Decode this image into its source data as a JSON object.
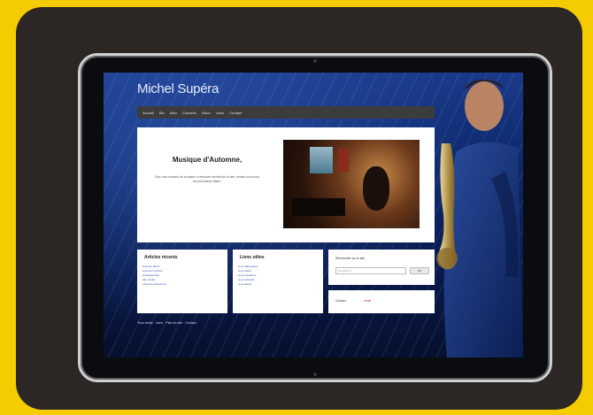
{
  "site": {
    "title": "Michel Supéra",
    "nav": [
      "Accueil",
      "Bio",
      "Actu",
      "Concerts",
      "Disco",
      "Liens",
      "Contact"
    ]
  },
  "hero": {
    "title": "Musique d'Automne,",
    "text": "Tous nos concerts de la saison à retrouver bientôt sur le site, rendez-vous pour les prochaines dates."
  },
  "articles_box": {
    "title": "Articles récents",
    "items": [
      "Nouvel album",
      "Concert à Paris",
      "Festival d'été",
      "En studio",
      "Tournée d'automne"
    ]
  },
  "links_box": {
    "title": "Liens utiles",
    "items": [
      "Les partenaires",
      "Les salles",
      "Les musiciens",
      "Les festivals",
      "Les labels"
    ]
  },
  "search_box": {
    "label": "Rechercher sur le site",
    "placeholder": "Recherche...",
    "button": "OK"
  },
  "contact_box": {
    "label": "Contact",
    "value": "email"
  },
  "footer": {
    "text": "Tous droits · Liens · Plan du site · Contact"
  },
  "colors": {
    "page_bg": "#f5cc00",
    "frame": "#2c2624",
    "nav_bar": "#3c3c3c",
    "link": "#3355aa"
  }
}
